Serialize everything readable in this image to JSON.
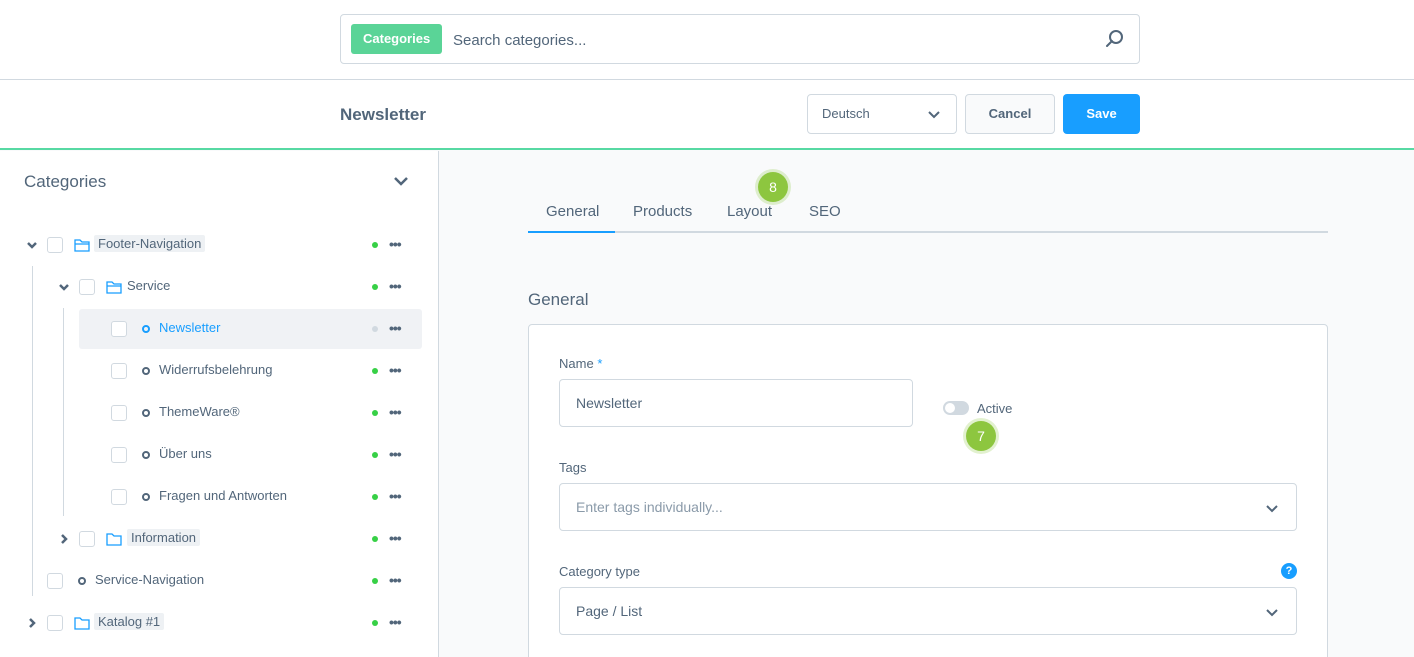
{
  "search": {
    "chip_label": "Categories",
    "placeholder": "Search categories..."
  },
  "smartbar": {
    "title": "Newsletter",
    "language": "Deutsch",
    "cancel_label": "Cancel",
    "save_label": "Save"
  },
  "sidebar": {
    "title": "Categories",
    "items": [
      {
        "label": "Footer-Navigation",
        "status": "active"
      },
      {
        "label": "Service",
        "status": "active"
      },
      {
        "label": "Newsletter",
        "status": "inactive",
        "selected": true
      },
      {
        "label": "Widerrufsbelehrung",
        "status": "active"
      },
      {
        "label": "ThemeWare®",
        "status": "active"
      },
      {
        "label": "Über uns",
        "status": "active"
      },
      {
        "label": "Fragen und Antworten",
        "status": "active"
      },
      {
        "label": "Information",
        "status": "active"
      },
      {
        "label": "Service-Navigation",
        "status": "active"
      },
      {
        "label": "Katalog #1",
        "status": "active"
      }
    ]
  },
  "tabs": [
    {
      "label": "General",
      "active": true
    },
    {
      "label": "Products"
    },
    {
      "label": "Layout"
    },
    {
      "label": "SEO"
    }
  ],
  "badges": {
    "layout_tab": "8",
    "active_toggle": "7"
  },
  "general": {
    "section_title": "General",
    "name_label": "Name",
    "name_required": "*",
    "name_value": "Newsletter",
    "active_label": "Active",
    "active_on": false,
    "tags_label": "Tags",
    "tags_placeholder": "Enter tags individually...",
    "category_type_label": "Category type",
    "category_type_value": "Page / List",
    "help_glyph": "?"
  },
  "colors": {
    "accent": "#189eff",
    "chip": "#5ad497",
    "status_active": "#37d046",
    "badge": "#8dc63f"
  }
}
